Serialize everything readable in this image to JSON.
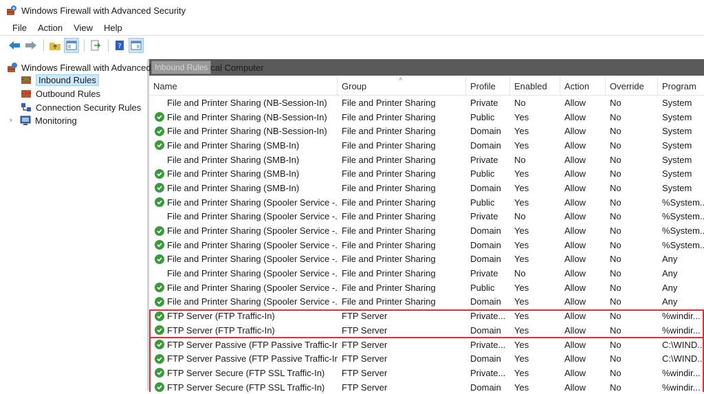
{
  "window": {
    "title": "Windows Firewall with Advanced Security"
  },
  "menu": [
    "File",
    "Action",
    "View",
    "Help"
  ],
  "tree": {
    "root": "Windows Firewall with Advanced Security on Local Computer",
    "tooltip": "Inbound Rules",
    "items": [
      {
        "label": "Inbound Rules",
        "icon": "inbound-rules-icon",
        "selected": true
      },
      {
        "label": "Outbound Rules",
        "icon": "outbound-rules-icon",
        "selected": false
      },
      {
        "label": "Connection Security Rules",
        "icon": "connection-security-icon",
        "selected": false
      },
      {
        "label": "Monitoring",
        "icon": "monitoring-icon",
        "selected": false
      }
    ]
  },
  "columns": [
    "Name",
    "Group",
    "Profile",
    "Enabled",
    "Action",
    "Override",
    "Program"
  ],
  "rows": [
    {
      "name": "File and Printer Sharing (NB-Session-In)",
      "group": "File and Printer Sharing",
      "profile": "Private",
      "enabled": "No",
      "action": "Allow",
      "override": "No",
      "program": "System",
      "icon": false
    },
    {
      "name": "File and Printer Sharing (NB-Session-In)",
      "group": "File and Printer Sharing",
      "profile": "Public",
      "enabled": "Yes",
      "action": "Allow",
      "override": "No",
      "program": "System",
      "icon": true
    },
    {
      "name": "File and Printer Sharing (NB-Session-In)",
      "group": "File and Printer Sharing",
      "profile": "Domain",
      "enabled": "Yes",
      "action": "Allow",
      "override": "No",
      "program": "System",
      "icon": true
    },
    {
      "name": "File and Printer Sharing (SMB-In)",
      "group": "File and Printer Sharing",
      "profile": "Domain",
      "enabled": "Yes",
      "action": "Allow",
      "override": "No",
      "program": "System",
      "icon": true
    },
    {
      "name": "File and Printer Sharing (SMB-In)",
      "group": "File and Printer Sharing",
      "profile": "Private",
      "enabled": "No",
      "action": "Allow",
      "override": "No",
      "program": "System",
      "icon": false
    },
    {
      "name": "File and Printer Sharing (SMB-In)",
      "group": "File and Printer Sharing",
      "profile": "Public",
      "enabled": "Yes",
      "action": "Allow",
      "override": "No",
      "program": "System",
      "icon": true
    },
    {
      "name": "File and Printer Sharing (SMB-In)",
      "group": "File and Printer Sharing",
      "profile": "Domain",
      "enabled": "Yes",
      "action": "Allow",
      "override": "No",
      "program": "System",
      "icon": true
    },
    {
      "name": "File and Printer Sharing (Spooler Service -...",
      "group": "File and Printer Sharing",
      "profile": "Public",
      "enabled": "Yes",
      "action": "Allow",
      "override": "No",
      "program": "%System...",
      "icon": true
    },
    {
      "name": "File and Printer Sharing (Spooler Service -...",
      "group": "File and Printer Sharing",
      "profile": "Private",
      "enabled": "No",
      "action": "Allow",
      "override": "No",
      "program": "%System...",
      "icon": false
    },
    {
      "name": "File and Printer Sharing (Spooler Service -...",
      "group": "File and Printer Sharing",
      "profile": "Domain",
      "enabled": "Yes",
      "action": "Allow",
      "override": "No",
      "program": "%System...",
      "icon": true
    },
    {
      "name": "File and Printer Sharing (Spooler Service -...",
      "group": "File and Printer Sharing",
      "profile": "Domain",
      "enabled": "Yes",
      "action": "Allow",
      "override": "No",
      "program": "%System...",
      "icon": true
    },
    {
      "name": "File and Printer Sharing (Spooler Service -...",
      "group": "File and Printer Sharing",
      "profile": "Domain",
      "enabled": "Yes",
      "action": "Allow",
      "override": "No",
      "program": "Any",
      "icon": true
    },
    {
      "name": "File and Printer Sharing (Spooler Service -...",
      "group": "File and Printer Sharing",
      "profile": "Private",
      "enabled": "No",
      "action": "Allow",
      "override": "No",
      "program": "Any",
      "icon": false
    },
    {
      "name": "File and Printer Sharing (Spooler Service -...",
      "group": "File and Printer Sharing",
      "profile": "Public",
      "enabled": "Yes",
      "action": "Allow",
      "override": "No",
      "program": "Any",
      "icon": true
    },
    {
      "name": "File and Printer Sharing (Spooler Service -...",
      "group": "File and Printer Sharing",
      "profile": "Domain",
      "enabled": "Yes",
      "action": "Allow",
      "override": "No",
      "program": "Any",
      "icon": true
    },
    {
      "name": "FTP Server (FTP Traffic-In)",
      "group": "FTP Server",
      "profile": "Private...",
      "enabled": "Yes",
      "action": "Allow",
      "override": "No",
      "program": "%windir...",
      "icon": true
    },
    {
      "name": "FTP Server (FTP Traffic-In)",
      "group": "FTP Server",
      "profile": "Domain",
      "enabled": "Yes",
      "action": "Allow",
      "override": "No",
      "program": "%windir...",
      "icon": true
    },
    {
      "name": "FTP Server Passive (FTP Passive Traffic-In)",
      "group": "FTP Server",
      "profile": "Private...",
      "enabled": "Yes",
      "action": "Allow",
      "override": "No",
      "program": "C:\\WIND...",
      "icon": true
    },
    {
      "name": "FTP Server Passive (FTP Passive Traffic-In)",
      "group": "FTP Server",
      "profile": "Domain",
      "enabled": "Yes",
      "action": "Allow",
      "override": "No",
      "program": "C:\\WIND...",
      "icon": true
    },
    {
      "name": "FTP Server Secure (FTP SSL Traffic-In)",
      "group": "FTP Server",
      "profile": "Private...",
      "enabled": "Yes",
      "action": "Allow",
      "override": "No",
      "program": "%windir...",
      "icon": true
    },
    {
      "name": "FTP Server Secure (FTP SSL Traffic-In)",
      "group": "FTP Server",
      "profile": "Domain",
      "enabled": "Yes",
      "action": "Allow",
      "override": "No",
      "program": "%windir...",
      "icon": true
    }
  ],
  "highlight_color": "#e0303a",
  "enabled_icon_color": "#3b9a3b"
}
